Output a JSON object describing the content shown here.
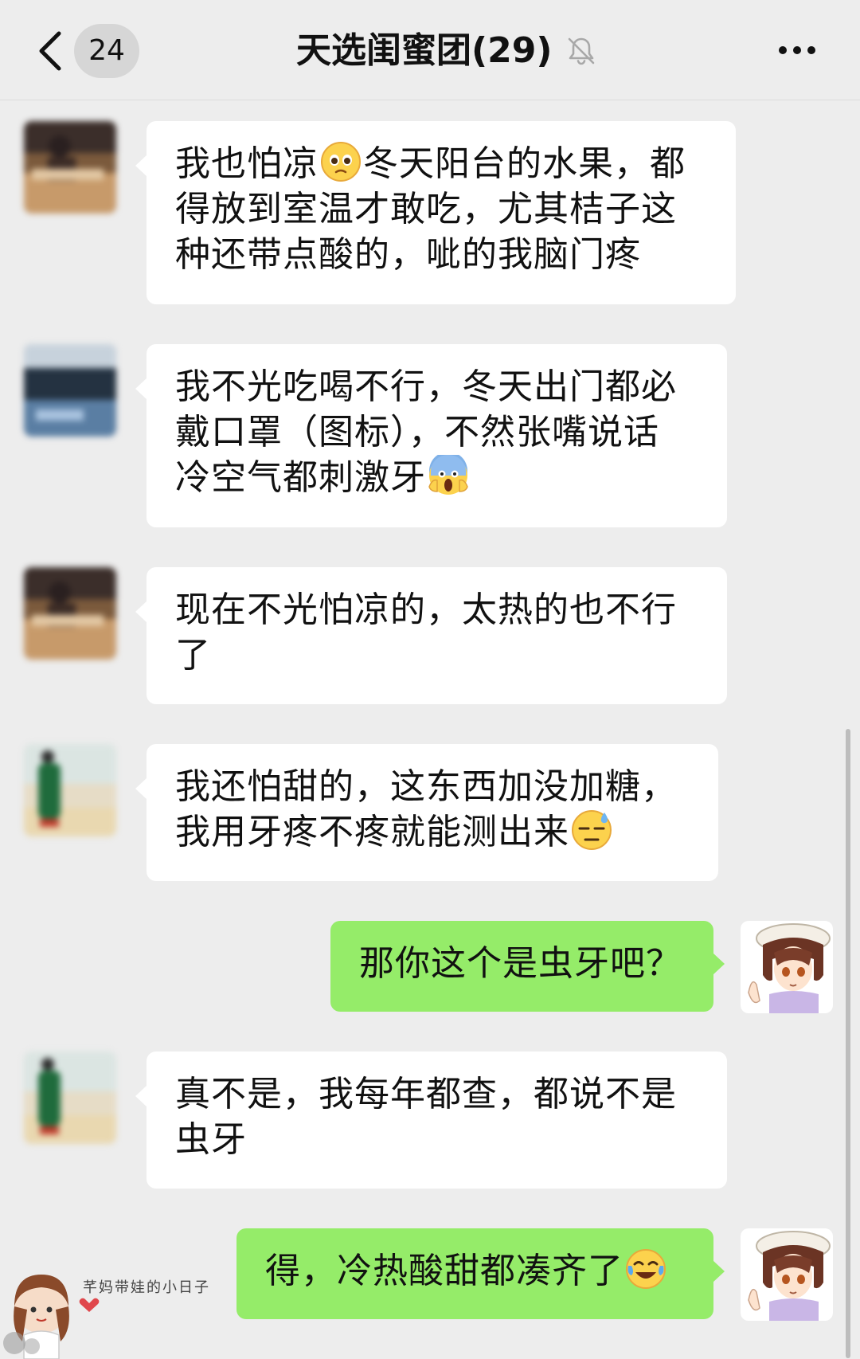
{
  "header": {
    "unread_count": "24",
    "title": "天选闺蜜团(29)"
  },
  "messages": [
    {
      "side": "left",
      "avatar": "avatar-1",
      "parts": [
        "我也怕凉",
        "[pleading-emoji]",
        "冬天阳台的水果，都得放到室温才敢吃，尤其桔子这种还带点酸的，呲的我脑门疼"
      ]
    },
    {
      "side": "left",
      "avatar": "avatar-2",
      "parts": [
        "我不光吃喝不行，冬天出门都必戴口罩（图标），不然张嘴说话冷空气都刺激牙",
        "[scream-emoji]"
      ]
    },
    {
      "side": "left",
      "avatar": "avatar-1",
      "parts": [
        "现在不光怕凉的，太热的也不行了"
      ]
    },
    {
      "side": "left",
      "avatar": "avatar-3",
      "parts": [
        "我还怕甜的，这东西加没加糖，我用牙疼不疼就能测出来",
        "[sweat-emoji]"
      ]
    },
    {
      "side": "right",
      "avatar": "self-avatar",
      "parts": [
        "那你这个是虫牙吧？"
      ]
    },
    {
      "side": "left",
      "avatar": "avatar-3",
      "parts": [
        "真不是，我每年都查，都说不是虫牙"
      ]
    },
    {
      "side": "right",
      "avatar": "self-avatar",
      "parts": [
        "得，冷热酸甜都凑齐了",
        "[laugh-cry-emoji]"
      ]
    }
  ],
  "m1": {
    "a": "我也怕凉",
    "b": "冬天阳台的水果，都",
    "c": "得放到室温才敢吃，尤其桔子这",
    "d": "种还带点酸的，呲的我脑门疼"
  },
  "m2": {
    "a": "我不光吃喝不行，冬天出门都必",
    "b": "戴口罩（图标），不然张嘴说话",
    "c": "冷空气都刺激牙"
  },
  "m3": {
    "a": "现在不光怕凉的，太热的也不行",
    "b": "了"
  },
  "m4": {
    "a": "我还怕甜的，这东西加没加糖，",
    "b": "我用牙疼不疼就能测出来"
  },
  "m5": {
    "a": "那你这个是虫牙吧？"
  },
  "m6": {
    "a": "真不是，我每年都查，都说不是",
    "b": "虫牙"
  },
  "m7": {
    "a": "得，冷热酸甜都凑齐了"
  },
  "watermark": {
    "text": "芊妈带娃的小日子"
  },
  "colors": {
    "background": "#ededed",
    "bubble_left": "#ffffff",
    "bubble_right": "#95ec69"
  }
}
